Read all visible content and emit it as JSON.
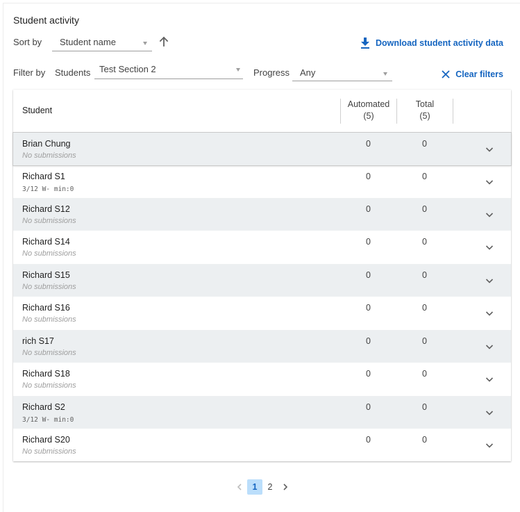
{
  "title": "Student activity",
  "sort": {
    "label": "Sort by",
    "value": "Sort by"
  },
  "sort_value": "Student name",
  "download_label": "Download student activity data",
  "filter": {
    "label": "Filter by",
    "students_label": "Students",
    "students_value": "Test Section 2",
    "progress_label": "Progress",
    "progress_value": "Any",
    "clear_label": "Clear filters"
  },
  "table": {
    "headers": {
      "student": "Student",
      "automated": "Automated",
      "automated_count": "(5)",
      "total": "Total",
      "total_count": "(5)"
    },
    "rows": [
      {
        "name": "Brian Chung",
        "sub": "No submissions",
        "automated": "0",
        "total": "0"
      },
      {
        "name": "Richard S1",
        "sub": "3/12 W- min:0",
        "automated": "0",
        "total": "0"
      },
      {
        "name": "Richard S12",
        "sub": "No submissions",
        "automated": "0",
        "total": "0"
      },
      {
        "name": "Richard S14",
        "sub": "No submissions",
        "automated": "0",
        "total": "0"
      },
      {
        "name": "Richard S15",
        "sub": "No submissions",
        "automated": "0",
        "total": "0"
      },
      {
        "name": "Richard S16",
        "sub": "No submissions",
        "automated": "0",
        "total": "0"
      },
      {
        "name": "rich S17",
        "sub": "No submissions",
        "automated": "0",
        "total": "0"
      },
      {
        "name": "Richard S18",
        "sub": "No submissions",
        "automated": "0",
        "total": "0"
      },
      {
        "name": "Richard S2",
        "sub": "3/12 W- min:0",
        "automated": "0",
        "total": "0"
      },
      {
        "name": "Richard S20",
        "sub": "No submissions",
        "automated": "0",
        "total": "0"
      }
    ]
  },
  "pagination": {
    "pages": [
      "1",
      "2"
    ],
    "current": "1"
  },
  "colors": {
    "accent": "#1565c0",
    "row_alt": "#eceff1",
    "active_page_bg": "#bbdefb"
  }
}
